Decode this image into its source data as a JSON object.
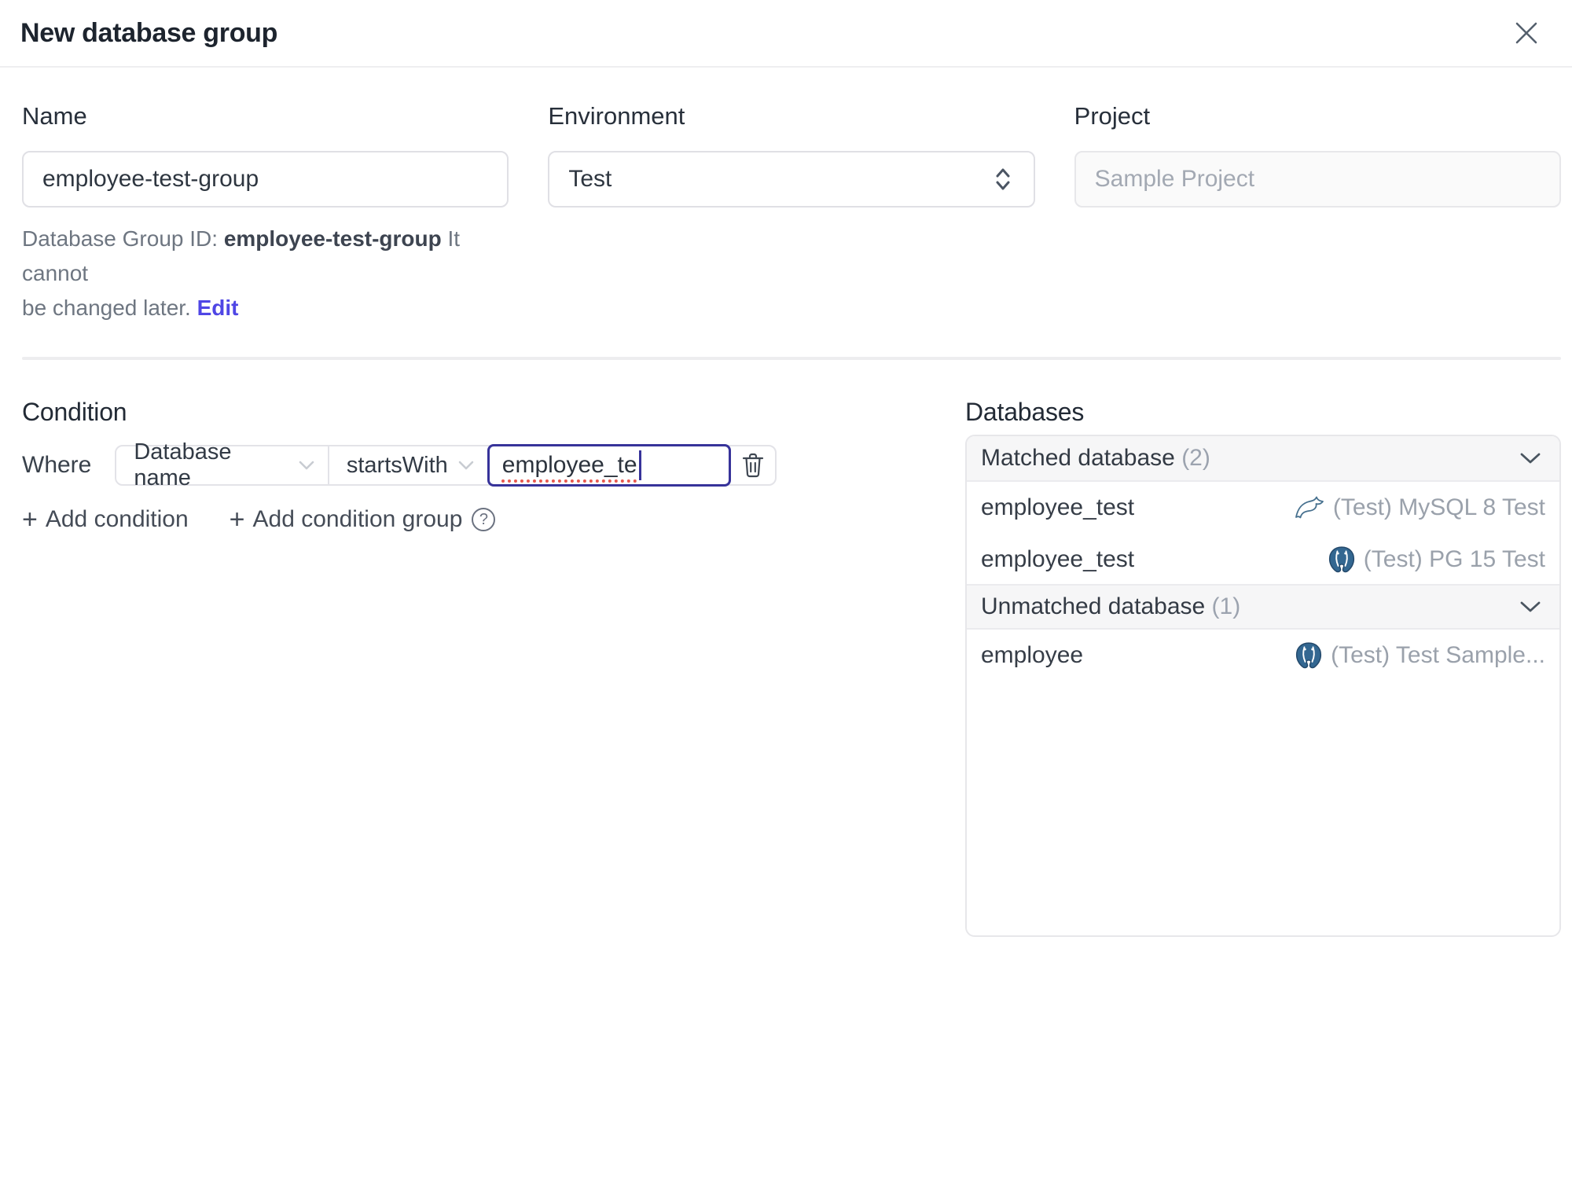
{
  "dialog": {
    "title": "New database group"
  },
  "form": {
    "name": {
      "label": "Name",
      "value": "employee-test-group"
    },
    "environment": {
      "label": "Environment",
      "value": "Test"
    },
    "project": {
      "label": "Project",
      "value": "Sample Project"
    },
    "group_id_help": {
      "line1_prefix": "Database Group ID: ",
      "id": "employee-test-group",
      "line1_suffix": " It cannot",
      "line2": "be changed later. ",
      "edit_label": "Edit"
    }
  },
  "condition": {
    "heading": "Condition",
    "where_label": "Where",
    "factor": "Database name",
    "operator": "startsWith",
    "value": "employee_te",
    "add_condition_label": "Add condition",
    "add_condition_group_label": "Add condition group"
  },
  "databases": {
    "heading": "Databases",
    "groups": [
      {
        "title": "Matched database",
        "count": "(2)",
        "rows": [
          {
            "name": "employee_test",
            "engine": "mysql",
            "instance": "(Test) MySQL 8 Test"
          },
          {
            "name": "employee_test",
            "engine": "postgresql",
            "instance": "(Test) PG 15 Test"
          }
        ]
      },
      {
        "title": "Unmatched database",
        "count": "(1)",
        "rows": [
          {
            "name": "employee",
            "engine": "postgresql",
            "instance": "(Test) Test Sample..."
          }
        ]
      }
    ]
  },
  "icons": {
    "plus": "+",
    "help": "?"
  },
  "colors": {
    "accent_link": "#4f46e5",
    "focus_border": "#37339a",
    "spellcheck_underline": "#e8594f",
    "mysql_icon": "#46708e",
    "postgresql_icon": "#336791"
  }
}
